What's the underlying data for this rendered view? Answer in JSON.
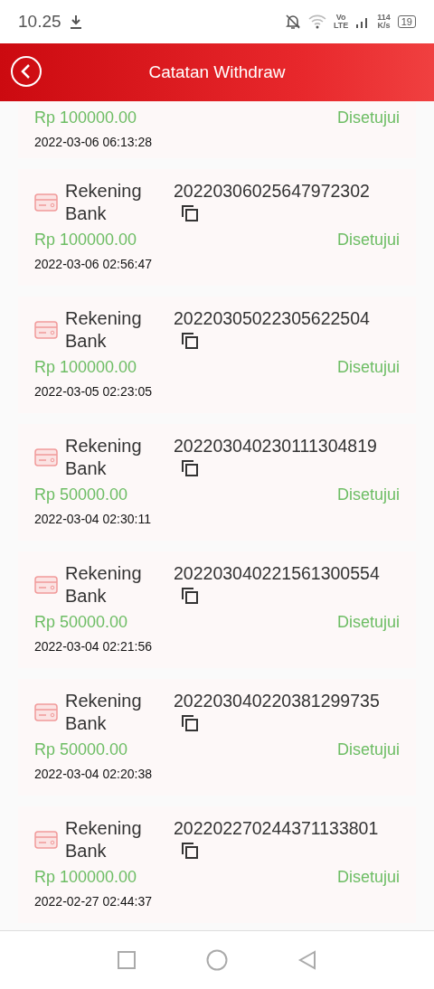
{
  "status_bar": {
    "time": "10.25",
    "network": "Vo",
    "network_type": "LTE",
    "speed": "114",
    "speed_unit": "K/s",
    "battery": "19"
  },
  "header": {
    "title": "Catatan Withdraw"
  },
  "records": [
    {
      "amount": "Rp 100000.00",
      "status": "Disetujui",
      "time": "2022-03-06 06:13:28"
    },
    {
      "method_line1": "Rekening",
      "method_line2": "Bank",
      "id": "20220306025647972302",
      "amount": "Rp 100000.00",
      "status": "Disetujui",
      "time": "2022-03-06 02:56:47"
    },
    {
      "method_line1": "Rekening",
      "method_line2": "Bank",
      "id": "20220305022305622504",
      "amount": "Rp 100000.00",
      "status": "Disetujui",
      "time": "2022-03-05 02:23:05"
    },
    {
      "method_line1": "Rekening",
      "method_line2": "Bank",
      "id": "202203040230111304819",
      "amount": "Rp 50000.00",
      "status": "Disetujui",
      "time": "2022-03-04 02:30:11"
    },
    {
      "method_line1": "Rekening",
      "method_line2": "Bank",
      "id": "202203040221561300554",
      "amount": "Rp 50000.00",
      "status": "Disetujui",
      "time": "2022-03-04 02:21:56"
    },
    {
      "method_line1": "Rekening",
      "method_line2": "Bank",
      "id": "202203040220381299735",
      "amount": "Rp 50000.00",
      "status": "Disetujui",
      "time": "2022-03-04 02:20:38"
    },
    {
      "method_line1": "Rekening",
      "method_line2": "Bank",
      "id": "202202270244371133801",
      "amount": "Rp 100000.00",
      "status": "Disetujui",
      "time": "2022-02-27 02:44:37"
    }
  ]
}
